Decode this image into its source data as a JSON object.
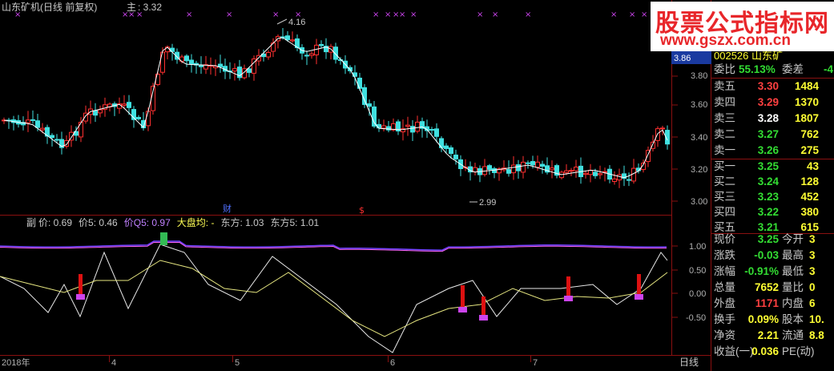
{
  "header": {
    "title": "山东矿机(日线 前复权)",
    "main_label": "主",
    "main_value": ": 3.32"
  },
  "main_chart": {
    "high_label": "4.16",
    "low_label": "2.99",
    "marker_cai": "财",
    "marker_s": "$",
    "y_ticks": [
      "3.80",
      "3.60",
      "3.40",
      "3.20",
      "3.00"
    ],
    "price_tag": "3.86"
  },
  "sub_chart": {
    "title": "副",
    "legend": [
      {
        "label": "价: 0.69",
        "color": "#c8c8c8"
      },
      {
        "label": "价5: 0.46",
        "color": "#c8c8c8"
      },
      {
        "label": "价Q5: 0.97",
        "color": "#c080ff"
      },
      {
        "label": "大盘均: -",
        "color": "#ffff55"
      },
      {
        "label": "东方: 1.03",
        "color": "#c8c8c8"
      },
      {
        "label": "东方5: 1.01",
        "color": "#c8c8c8"
      }
    ],
    "y_ticks": [
      "1.00",
      "0.50",
      "0.00",
      "-0.50"
    ]
  },
  "x_axis": {
    "labels": [
      "2018年",
      "4",
      "5",
      "6",
      "7"
    ],
    "period_button": "日线"
  },
  "watermark": {
    "line1": "股票公式指标网",
    "line2": "www.gszx.com.cn"
  },
  "quote_panel": {
    "code_partial": "002526 山东矿",
    "wei_bi_label": "委比",
    "wei_bi_value": "55.13%",
    "wei_cha_label": "委差",
    "wei_cha_value": "-4",
    "asks": [
      {
        "label": "卖五",
        "price": "3.30",
        "volume": "1484",
        "color": "#ff4040"
      },
      {
        "label": "卖四",
        "price": "3.29",
        "volume": "1370",
        "color": "#ff4040"
      },
      {
        "label": "卖三",
        "price": "3.28",
        "volume": "1807",
        "color": "#ffffff"
      },
      {
        "label": "卖二",
        "price": "3.27",
        "volume": "762",
        "color": "#33dd33"
      },
      {
        "label": "卖一",
        "price": "3.26",
        "volume": "275",
        "color": "#33dd33"
      }
    ],
    "bids": [
      {
        "label": "买一",
        "price": "3.25",
        "volume": "43",
        "color": "#33dd33"
      },
      {
        "label": "买二",
        "price": "3.24",
        "volume": "128",
        "color": "#33dd33"
      },
      {
        "label": "买三",
        "price": "3.23",
        "volume": "452",
        "color": "#33dd33"
      },
      {
        "label": "买四",
        "price": "3.22",
        "volume": "380",
        "color": "#33dd33"
      },
      {
        "label": "买五",
        "price": "3.21",
        "volume": "615",
        "color": "#33dd33"
      }
    ],
    "stats": [
      {
        "l1": "现价",
        "v1": "3.25",
        "c1": "#33dd33",
        "l2": "今开",
        "v2": "3"
      },
      {
        "l1": "涨跌",
        "v1": "-0.03",
        "c1": "#33dd33",
        "l2": "最高",
        "v2": "3"
      },
      {
        "l1": "涨幅",
        "v1": "-0.91%",
        "c1": "#33dd33",
        "l2": "最低",
        "v2": "3"
      },
      {
        "l1": "总量",
        "v1": "7652",
        "c1": "#ffff33",
        "l2": "量比",
        "v2": "0"
      },
      {
        "l1": "外盘",
        "v1": "1171",
        "c1": "#ff4040",
        "l2": "内盘",
        "v2": "6"
      },
      {
        "l1": "换手",
        "v1": "0.09%",
        "c1": "#ffff33",
        "l2": "股本",
        "v2": "10."
      },
      {
        "l1": "净资",
        "v1": "2.21",
        "c1": "#ffff33",
        "l2": "流通",
        "v2": "8.8"
      },
      {
        "l1": "收益(一)",
        "v1": "0.036",
        "c1": "#ffff33",
        "l2": "PE(动)",
        "v2": ""
      }
    ]
  },
  "colors": {
    "up": "#ff3030",
    "down": "#40e0e0",
    "ma": "#ffffff",
    "grid": "#8a1010",
    "signal_red": "#dd1111",
    "signal_magenta": "#cc44ee",
    "signal_green": "#33bb55"
  }
}
